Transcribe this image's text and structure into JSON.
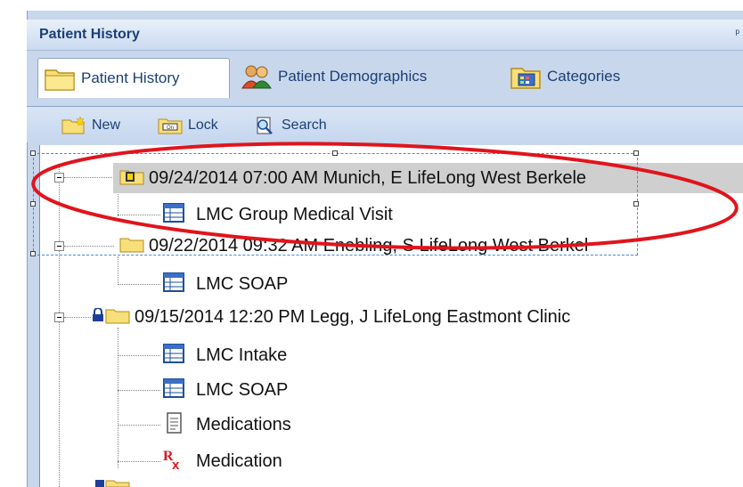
{
  "header": {
    "title": "Patient History"
  },
  "tabs": [
    {
      "label": "Patient History",
      "active": true
    },
    {
      "label": "Patient Demographics",
      "active": false
    },
    {
      "label": "Categories",
      "active": false
    }
  ],
  "toolbar": {
    "new_label": "New",
    "lock_label": "Lock",
    "search_label": "Search"
  },
  "tree": {
    "visits": [
      {
        "label": "09/24/2014 07:00 AM  Munich, E LifeLong West Berkele",
        "selected": true,
        "locked": false,
        "children": [
          {
            "label": "LMC Group Medical Visit",
            "icon": "form-icon"
          }
        ]
      },
      {
        "label": "09/22/2014 09:32 AM  Enebling, S LifeLong West Berkel",
        "selected": false,
        "locked": false,
        "children": [
          {
            "label": "LMC SOAP",
            "icon": "form-icon"
          }
        ]
      },
      {
        "label": "09/15/2014 12:20 PM  Legg, J LifeLong Eastmont Clinic",
        "selected": false,
        "locked": true,
        "children": [
          {
            "label": "LMC Intake",
            "icon": "form-icon"
          },
          {
            "label": "LMC SOAP",
            "icon": "form-icon"
          },
          {
            "label": "Medications",
            "icon": "document-icon"
          },
          {
            "label": "Medication",
            "icon": "rx-icon"
          }
        ]
      }
    ]
  },
  "colors": {
    "annotation": "#e0141c",
    "selection": "#3b8be0",
    "header_text": "#1b3f74"
  }
}
